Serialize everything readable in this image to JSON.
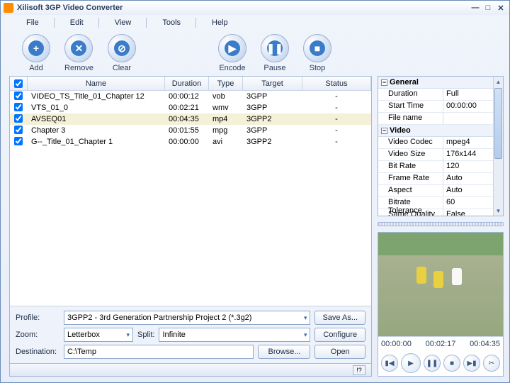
{
  "title": "Xilisoft 3GP Video Converter",
  "menu": [
    "File",
    "Edit",
    "View",
    "Tools",
    "Help"
  ],
  "toolbar": [
    {
      "name": "add",
      "label": "Add",
      "glyph": "+"
    },
    {
      "name": "remove",
      "label": "Remove",
      "glyph": "✕"
    },
    {
      "name": "clear",
      "label": "Clear",
      "glyph": "⊘"
    },
    {
      "name": "encode",
      "label": "Encode",
      "glyph": "▶"
    },
    {
      "name": "pause",
      "label": "Pause",
      "glyph": "❚❚"
    },
    {
      "name": "stop",
      "label": "Stop",
      "glyph": "■"
    }
  ],
  "columns": {
    "name": "Name",
    "duration": "Duration",
    "type": "Type",
    "target": "Target",
    "status": "Status"
  },
  "rows": [
    {
      "checked": true,
      "name": "VIDEO_TS_Title_01_Chapter 12",
      "duration": "00:00:12",
      "type": "vob",
      "target": "3GPP",
      "status": "-",
      "sel": false
    },
    {
      "checked": true,
      "name": "VTS_01_0",
      "duration": "00:02:21",
      "type": "wmv",
      "target": "3GPP",
      "status": "-",
      "sel": false
    },
    {
      "checked": true,
      "name": "AVSEQ01",
      "duration": "00:04:35",
      "type": "mp4",
      "target": "3GPP2",
      "status": "-",
      "sel": true
    },
    {
      "checked": true,
      "name": "Chapter 3",
      "duration": "00:01:55",
      "type": "mpg",
      "target": "3GPP",
      "status": "-",
      "sel": false
    },
    {
      "checked": true,
      "name": "G--_Title_01_Chapter 1",
      "duration": "00:00:00",
      "type": "avi",
      "target": "3GPP2",
      "status": "-",
      "sel": false
    }
  ],
  "bottom": {
    "profile_label": "Profile:",
    "profile_value": "3GPP2 - 3rd Generation Partnership Project 2  (*.3g2)",
    "saveas": "Save As...",
    "zoom_label": "Zoom:",
    "zoom_value": "Letterbox",
    "split_label": "Split:",
    "split_value": "Infinite",
    "configure": "Configure",
    "dest_label": "Destination:",
    "dest_value": "C:\\Temp",
    "browse": "Browse...",
    "open": "Open"
  },
  "status_help": "!?",
  "props": {
    "groups": [
      {
        "name": "General",
        "rows": [
          {
            "k": "Duration",
            "v": "Full"
          },
          {
            "k": "Start Time",
            "v": "00:00:00"
          },
          {
            "k": "File name",
            "v": ""
          }
        ]
      },
      {
        "name": "Video",
        "rows": [
          {
            "k": "Video Codec",
            "v": "mpeg4"
          },
          {
            "k": "Video Size",
            "v": "176x144"
          },
          {
            "k": "Bit Rate",
            "v": "120"
          },
          {
            "k": "Frame Rate",
            "v": "Auto"
          },
          {
            "k": "Aspect",
            "v": "Auto"
          },
          {
            "k": "Bitrate Tolerance",
            "v": "60"
          },
          {
            "k": "Same Quality",
            "v": "False"
          }
        ]
      }
    ]
  },
  "timeline": {
    "t1": "00:00:00",
    "t2": "00:02:17",
    "t3": "00:04:35"
  }
}
